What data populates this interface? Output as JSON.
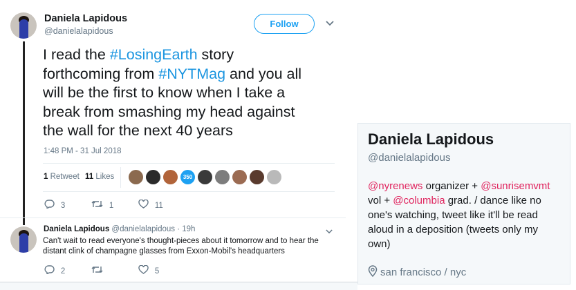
{
  "tweet": {
    "author_name": "Daniela Lapidous",
    "author_handle": "@danielalapidous",
    "follow_label": "Follow",
    "text_lines": [
      [
        {
          "t": "I read the "
        },
        {
          "t": "#LosingEarth",
          "tag": true
        },
        {
          "t": " story"
        }
      ],
      [
        {
          "t": "forthcoming from "
        },
        {
          "t": "#NYTMag",
          "tag": true
        },
        {
          "t": " and you all"
        }
      ],
      [
        {
          "t": "will be the first to know when I take a"
        }
      ],
      [
        {
          "t": "break from smashing my head against"
        }
      ],
      [
        {
          "t": "the wall for the next 40 years"
        }
      ]
    ],
    "timestamp": "1:48 PM - 31 Jul 2018",
    "retweets_count": "1",
    "retweets_label": "Retweet",
    "likes_count": "11",
    "likes_label": "Likes",
    "liker_badge": "350",
    "liker_colors": [
      "#8b6a4f",
      "#2b2b2b",
      "#b1643a",
      "#1da1f2",
      "#3a3a3a",
      "#7d7d7d",
      "#9b6b52",
      "#5a3b2e",
      "#b9b9b9"
    ],
    "actions": {
      "reply_count": "3",
      "retweet_count": "1",
      "like_count": "11"
    }
  },
  "profile_card": {
    "name": "Daniela Lapidous",
    "handle": "@danielalapidous",
    "bio_lines": [
      [
        {
          "t": "@nyrenews",
          "m": true
        },
        {
          "t": " organizer + "
        },
        {
          "t": "@sunrisemvmt",
          "m": true
        }
      ],
      [
        {
          "t": "vol + "
        },
        {
          "t": "@columbia",
          "m": true
        },
        {
          "t": " grad. / dance like no"
        }
      ],
      [
        {
          "t": "one's watching, tweet like it'll be read"
        }
      ],
      [
        {
          "t": "aloud in a deposition (tweets only my"
        }
      ],
      [
        {
          "t": "own)"
        }
      ]
    ],
    "location": "san francisco / nyc"
  },
  "reply": {
    "author_name": "Daniela Lapidous",
    "author_handle": "@danielalapidous",
    "time_ago": "· 19h",
    "text_lines": [
      "Can't wait to read everyone's thought-pieces about it tomorrow and to hear the",
      "distant clink of champagne glasses from Exxon-Mobil's headquarters"
    ],
    "actions": {
      "reply_count": "2",
      "retweet_count": "",
      "like_count": "5"
    }
  },
  "colors": {
    "link": "#1b95e0",
    "mention": "#e0245e",
    "muted": "#657786",
    "accent": "#1da1f2"
  },
  "icons": [
    "reply-icon",
    "retweet-icon",
    "heart-icon",
    "chevron-down-icon",
    "location-pin-icon"
  ]
}
